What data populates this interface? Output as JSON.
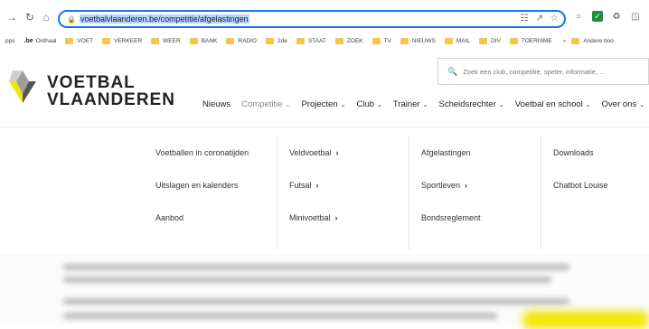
{
  "browser": {
    "url": "voetbalvlaanderen.be/competitie/afgelastingen",
    "bookmarks": [
      {
        "label": "pps",
        "type": "text"
      },
      {
        "label": "Onthaal",
        "type": "be"
      },
      {
        "label": "VOET",
        "type": "folder"
      },
      {
        "label": "VERKEER",
        "type": "folder"
      },
      {
        "label": "WEER",
        "type": "folder"
      },
      {
        "label": "BANK",
        "type": "folder"
      },
      {
        "label": "RADIO",
        "type": "folder"
      },
      {
        "label": "2de",
        "type": "folder"
      },
      {
        "label": "STAAT",
        "type": "folder"
      },
      {
        "label": "ZOEK",
        "type": "folder"
      },
      {
        "label": "TV",
        "type": "folder"
      },
      {
        "label": "NIEUWS",
        "type": "folder"
      },
      {
        "label": "MAIL",
        "type": "folder"
      },
      {
        "label": "DIV",
        "type": "folder"
      },
      {
        "label": "TOERISME",
        "type": "folder"
      }
    ],
    "overflow_label": "»",
    "other_bookmarks": "Andere boo",
    "be_badge": ".be",
    "avatar_letter": "C"
  },
  "site": {
    "logo_line1": "VOETBAL",
    "logo_line2": "VLAANDEREN",
    "search_placeholder": "Zoek een club, competitie, speler, informatie, ...",
    "nav": [
      {
        "label": "Nieuws",
        "caret": false,
        "active": false
      },
      {
        "label": "Competitie",
        "caret": true,
        "active": true
      },
      {
        "label": "Projecten",
        "caret": true,
        "active": false
      },
      {
        "label": "Club",
        "caret": true,
        "active": false
      },
      {
        "label": "Trainer",
        "caret": true,
        "active": false
      },
      {
        "label": "Scheidsrechter",
        "caret": true,
        "active": false
      },
      {
        "label": "Voetbal en school",
        "caret": true,
        "active": false
      },
      {
        "label": "Over ons",
        "caret": true,
        "active": false
      }
    ],
    "menu": {
      "col1": [
        "Voetballen in coronatijden",
        "Uitslagen en kalenders",
        "Aanbod"
      ],
      "col2": [
        "Veldvoetbal",
        "Futsal",
        "Minivoetbal"
      ],
      "col3": [
        "Afgelastingen",
        "Sportleven",
        "Bondsreglement"
      ],
      "col4": [
        "Downloads",
        "Chatbot Louise"
      ]
    }
  },
  "colors": {
    "accent": "#1a73e8",
    "brand_yellow": "#f2e600"
  }
}
